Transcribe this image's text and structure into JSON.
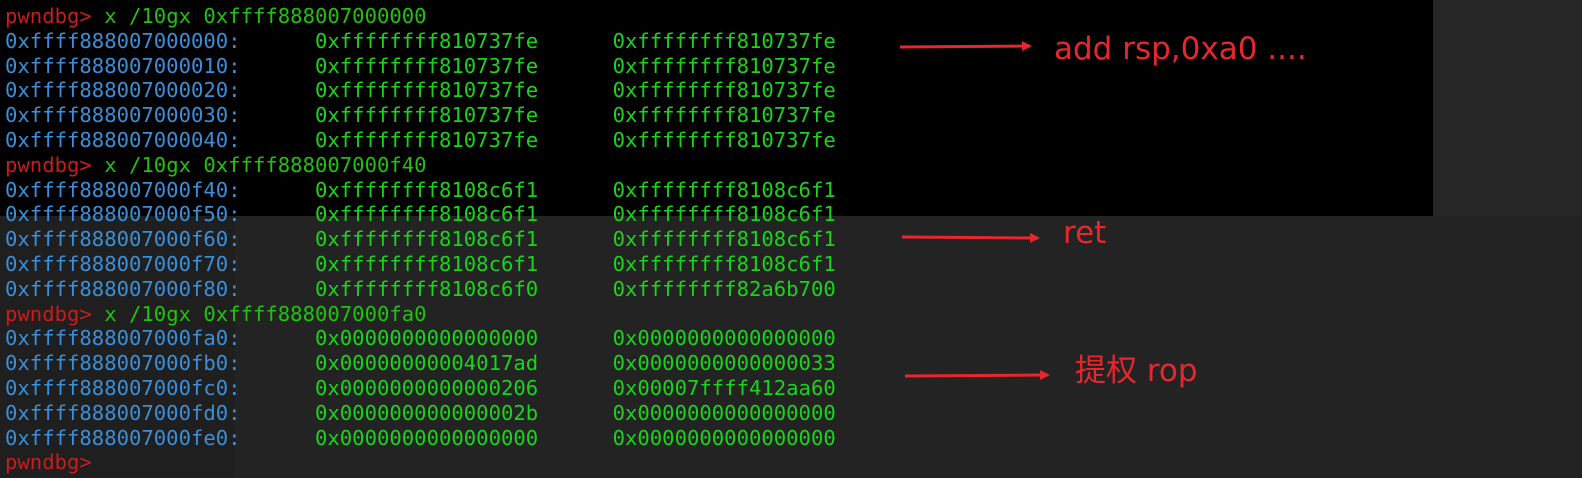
{
  "terminal": {
    "lines": [
      {
        "type": "cmd",
        "prompt": "pwndbg>",
        "text": " x /10gx 0xffff888007000000"
      },
      {
        "type": "mem",
        "addr": "0xffff888007000000:",
        "v1": "0xffffffff810737fe",
        "v2": "0xffffffff810737fe"
      },
      {
        "type": "mem",
        "addr": "0xffff888007000010:",
        "v1": "0xffffffff810737fe",
        "v2": "0xffffffff810737fe"
      },
      {
        "type": "mem",
        "addr": "0xffff888007000020:",
        "v1": "0xffffffff810737fe",
        "v2": "0xffffffff810737fe"
      },
      {
        "type": "mem",
        "addr": "0xffff888007000030:",
        "v1": "0xffffffff810737fe",
        "v2": "0xffffffff810737fe"
      },
      {
        "type": "mem",
        "addr": "0xffff888007000040:",
        "v1": "0xffffffff810737fe",
        "v2": "0xffffffff810737fe"
      },
      {
        "type": "cmd",
        "prompt": "pwndbg>",
        "text": " x /10gx 0xffff888007000f40"
      },
      {
        "type": "mem",
        "addr": "0xffff888007000f40:",
        "v1": "0xffffffff8108c6f1",
        "v2": "0xffffffff8108c6f1"
      },
      {
        "type": "mem",
        "addr": "0xffff888007000f50:",
        "v1": "0xffffffff8108c6f1",
        "v2": "0xffffffff8108c6f1"
      },
      {
        "type": "mem",
        "addr": "0xffff888007000f60:",
        "v1": "0xffffffff8108c6f1",
        "v2": "0xffffffff8108c6f1"
      },
      {
        "type": "mem",
        "addr": "0xffff888007000f70:",
        "v1": "0xffffffff8108c6f1",
        "v2": "0xffffffff8108c6f1"
      },
      {
        "type": "mem",
        "addr": "0xffff888007000f80:",
        "v1": "0xffffffff8108c6f0",
        "v2": "0xffffffff82a6b700"
      },
      {
        "type": "cmd",
        "prompt": "pwndbg>",
        "text": " x /10gx 0xffff888007000fa0"
      },
      {
        "type": "mem",
        "addr": "0xffff888007000fa0:",
        "v1": "0x0000000000000000",
        "v2": "0x0000000000000000"
      },
      {
        "type": "mem",
        "addr": "0xffff888007000fb0:",
        "v1": "0x00000000004017ad",
        "v2": "0x0000000000000033"
      },
      {
        "type": "mem",
        "addr": "0xffff888007000fc0:",
        "v1": "0x0000000000000206",
        "v2": "0x00007ffff412aa60"
      },
      {
        "type": "mem",
        "addr": "0xffff888007000fd0:",
        "v1": "0x000000000000002b",
        "v2": "0x0000000000000000"
      },
      {
        "type": "mem",
        "addr": "0xffff888007000fe0:",
        "v1": "0x0000000000000000",
        "v2": "0x0000000000000000"
      },
      {
        "type": "cmd",
        "prompt": "pwndbg>",
        "text": ""
      }
    ]
  },
  "annotations": {
    "note1": "add rsp,0xa0 ....",
    "note2": "ret",
    "note3": "提权 rop",
    "color": "#e8262d"
  },
  "colors": {
    "prompt": "#c71d1d",
    "command": "#20c20e",
    "address": "#3b8fd8",
    "value": "#1bd31b",
    "background": "#000000"
  }
}
